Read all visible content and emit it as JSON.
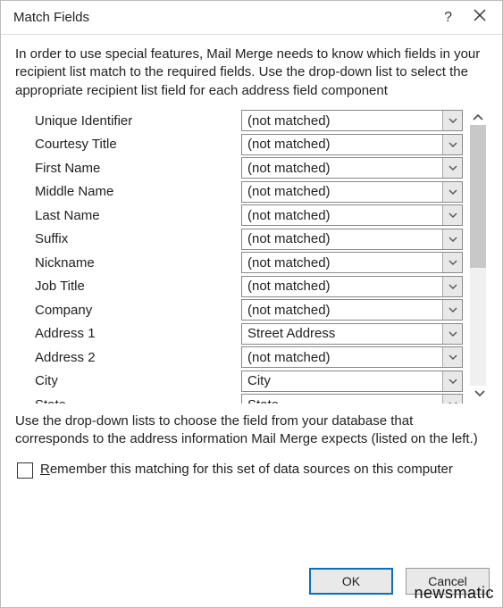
{
  "dialog": {
    "title": "Match Fields",
    "help_icon": "?",
    "close_icon": "×",
    "instructions_top": "In order to use special features, Mail Merge needs to know which fields in your recipient list match to the required fields.  Use the drop-down list to select the appropriate recipient list field for each address field component",
    "instructions_bottom": "Use the drop-down lists to choose the field from your database that corresponds to the address information Mail Merge expects (listed on the left.)",
    "checkbox_label_prefix": "R",
    "checkbox_label_rest": "emember this matching for this set of data sources on this computer",
    "ok_label": "OK",
    "cancel_label": "Cancel"
  },
  "fields": [
    {
      "label": "Unique Identifier",
      "value": "(not matched)"
    },
    {
      "label": "Courtesy Title",
      "value": "(not matched)"
    },
    {
      "label": "First Name",
      "value": "(not matched)"
    },
    {
      "label": "Middle Name",
      "value": "(not matched)"
    },
    {
      "label": "Last Name",
      "value": "(not matched)"
    },
    {
      "label": "Suffix",
      "value": "(not matched)"
    },
    {
      "label": "Nickname",
      "value": "(not matched)"
    },
    {
      "label": "Job Title",
      "value": "(not matched)"
    },
    {
      "label": "Company",
      "value": "(not matched)"
    },
    {
      "label": "Address 1",
      "value": "Street Address"
    },
    {
      "label": "Address 2",
      "value": "(not matched)"
    },
    {
      "label": "City",
      "value": "City"
    },
    {
      "label": "State",
      "value": "State"
    }
  ],
  "watermark": "newsmatic"
}
